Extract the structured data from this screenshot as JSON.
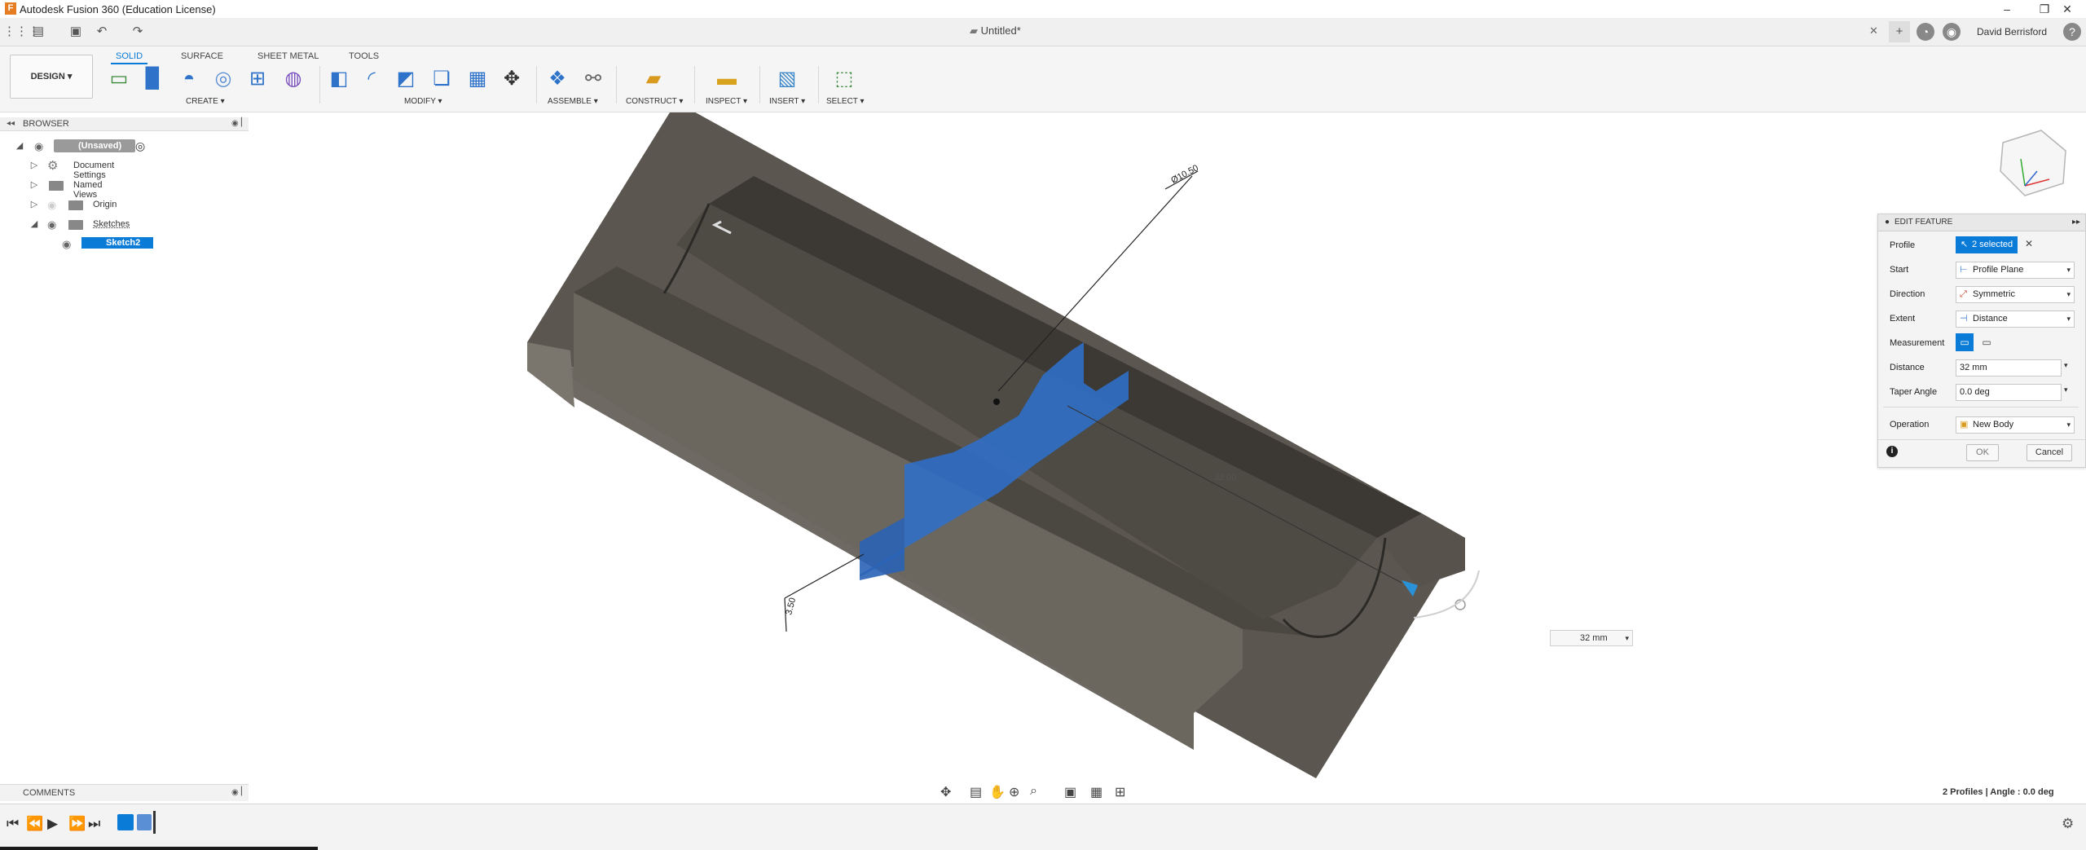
{
  "app": {
    "title": "Autodesk Fusion 360 (Education License)",
    "brand_color": "#e57d22"
  },
  "window_controls": {
    "minimize": "–",
    "maximize": "❐",
    "close": "✕"
  },
  "document": {
    "tab_title": "Untitled*",
    "tab_close": "✕"
  },
  "user": {
    "name": "David Berrisford"
  },
  "ribbon": {
    "workspace": "DESIGN ▾",
    "tabs": [
      "SOLID",
      "SURFACE",
      "SHEET METAL",
      "TOOLS"
    ],
    "groups": {
      "create": "CREATE ▾",
      "modify": "MODIFY ▾",
      "assemble": "ASSEMBLE ▾",
      "construct": "CONSTRUCT ▾",
      "inspect": "INSPECT ▾",
      "insert": "INSERT ▾",
      "select": "SELECT ▾"
    }
  },
  "browser": {
    "title": "BROWSER",
    "items": [
      {
        "label": "(Unsaved)"
      },
      {
        "label": "Document Settings"
      },
      {
        "label": "Named Views"
      },
      {
        "label": "Origin"
      },
      {
        "label": "Sketches"
      },
      {
        "label": "Sketch2"
      }
    ]
  },
  "comments": {
    "title": "COMMENTS"
  },
  "viewport": {
    "dimension_diameter": "Ø10.50",
    "dimension_distance": "32.00",
    "dimension_depth": "3.50",
    "inline_distance_value": "32 mm"
  },
  "edit_feature": {
    "title": "EDIT FEATURE",
    "expand": "▸▸",
    "profile_label": "Profile",
    "profile_value": "2 selected",
    "start_label": "Start",
    "start_value": "Profile Plane",
    "direction_label": "Direction",
    "direction_value": "Symmetric",
    "extent_label": "Extent",
    "extent_value": "Distance",
    "measurement_label": "Measurement",
    "distance_label": "Distance",
    "distance_value": "32 mm",
    "taper_label": "Taper Angle",
    "taper_value": "0.0 deg",
    "operation_label": "Operation",
    "operation_value": "New Body",
    "ok_label": "OK",
    "cancel_label": "Cancel"
  },
  "status": {
    "text": "2 Profiles | Angle : 0.0 deg"
  },
  "colors": {
    "accent": "#0a7bd6",
    "selection_blue": "#2f6fc9",
    "body_dark": "#4a4640"
  }
}
